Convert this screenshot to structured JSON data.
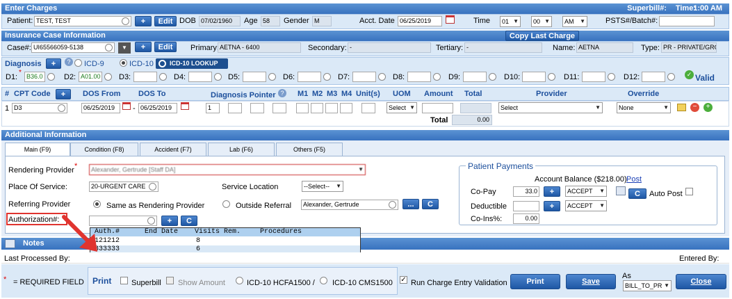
{
  "enter_charges": {
    "title": "Enter Charges",
    "superbill": "Superbill#:",
    "time_label": "Time:",
    "time_value": "1:00 AM",
    "patient_label": "Patient:",
    "patient_value": "TEST, TEST",
    "plus": "+",
    "edit": "Edit",
    "dob_label": "DOB",
    "dob_value": "07/02/1960",
    "age_label": "Age",
    "age_value": "58",
    "gender_label": "Gender",
    "gender_value": "M",
    "acct_date_label": "Acct. Date",
    "acct_date_value": "06/25/2019",
    "time2_label": "Time",
    "hour": "01",
    "minute": "00",
    "ampm": "AM",
    "psts_label": "PSTS#/Batch#:"
  },
  "insurance": {
    "title": "Insurance Case Information",
    "copy_last": "Copy Last Charge",
    "case_label": "Case#:",
    "case_value": "UI65566059-5138",
    "primary_label": "Primary:",
    "primary_value": "AETNA - 6400",
    "secondary_label": "Secondary:",
    "secondary_value": "-",
    "tertiary_label": "Tertiary:",
    "tertiary_value": "-",
    "name_label": "Name:",
    "name_value": "AETNA",
    "type_label": "Type:",
    "type_value": "PR - PRIVATE/GROUP"
  },
  "diagnosis": {
    "title": "Diagnosis",
    "icd9": "ICD-9",
    "icd10": "ICD-10",
    "lookup": "ICD-10 LOOKUP",
    "valid": "Valid",
    "d1_label": "D1:",
    "d1_value": "B36.0",
    "d2_label": "D2:",
    "d2_value": "A01.00",
    "d3": "D3:",
    "d4": "D4:",
    "d5": "D5:",
    "d6": "D6:",
    "d7": "D7:",
    "d8": "D8:",
    "d9": "D9:",
    "d10": "D10:",
    "d11": "D11:",
    "d12": "D12:"
  },
  "cpt": {
    "hash": "#",
    "cpt_code": "CPT Code",
    "dos_from": "DOS From",
    "dos_to": "DOS To",
    "diag_pointer": "Diagnosis Pointer",
    "m1": "M1",
    "m2": "M2",
    "m3": "M3",
    "m4": "M4",
    "units": "Unit(s)",
    "uom": "UOM",
    "amount": "Amount",
    "total": "Total",
    "provider": "Provider",
    "override": "Override",
    "row_num": "1",
    "row_cpt": "D3",
    "row_from": "06/25/2019",
    "dash": "-",
    "row_to": "06/25/2019",
    "row_pointer": "1",
    "row_uom": "Select",
    "row_provider": "Select",
    "row_override": "None",
    "total_label": "Total",
    "total_value": "0.00"
  },
  "additional": {
    "title": "Additional Information",
    "tabs": [
      "Main (F9)",
      "Condition (F8)",
      "Accident (F7)",
      "Lab (F6)",
      "Others (F5)"
    ],
    "rendering_label": "Rendering Provider",
    "rendering_value": "Alexander, Gertrude [Staff DA]",
    "pos_label": "Place Of Service:",
    "pos_value": "20-URGENT CARE",
    "service_loc_label": "Service Location",
    "service_loc_value": "--Select--",
    "referring_label": "Referring Provider",
    "same_label": "Same as Rendering Provider",
    "outside_label": "Outside Referral",
    "outside_value": "Alexander, Gertrude",
    "dots": "...",
    "c": "C",
    "auth_label": "Authorization#:",
    "auth_cols": [
      "Auth.#",
      "End Date",
      "Visits Rem.",
      "Procedures"
    ],
    "auth_rows": [
      {
        "auth": "121212",
        "end": "",
        "visits": "8",
        "proc": ""
      },
      {
        "auth": "333333",
        "end": "",
        "visits": "6",
        "proc": ""
      }
    ]
  },
  "payments": {
    "title": "Patient Payments",
    "balance": "Account Balance ($218.00)",
    "post": "Post",
    "copay_label": "Co-Pay",
    "copay_value": "33.0",
    "accept": "ACCEPT",
    "deductible_label": "Deductible",
    "coins_label": "Co-Ins%:",
    "coins_value": "0.00",
    "auto_post": "Auto Post"
  },
  "notes": {
    "title": "Notes"
  },
  "footer": {
    "last_processed": "Last Processed By:",
    "entered_by": "Entered By:",
    "required": "= REQUIRED FIELD",
    "print_label": "Print",
    "superbill": "Superbill",
    "show_amount": "Show Amount",
    "hcfa": "ICD-10 HCFA1500 /",
    "cms": "ICD-10 CMS1500",
    "run_validation": "Run Charge Entry Validation",
    "print_btn": "Print",
    "save_btn": "Save",
    "as_label": "As",
    "as_value": "BILL_TO_PR",
    "close_btn": "Close"
  },
  "colors": {
    "header_blue": "#3c76c2",
    "panel": "#dbe9f7",
    "annotation_red": "#e0342f"
  }
}
